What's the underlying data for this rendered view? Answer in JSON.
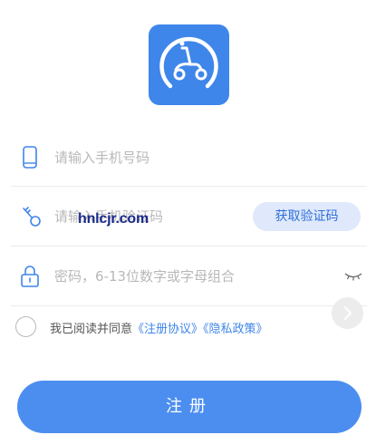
{
  "app": {
    "logo_icon": "scooter-icon",
    "accent_color": "#3f86ea"
  },
  "form": {
    "phone": {
      "placeholder": "请输入手机号码",
      "icon": "phone-icon"
    },
    "code": {
      "placeholder": "请输入手机验证码",
      "icon": "key-icon",
      "button_label": "获取验证码"
    },
    "password": {
      "placeholder": "密码，6-13位数字或字母组合",
      "icon": "lock-icon",
      "toggle_icon": "eye-closed-icon"
    }
  },
  "watermark": "hnlcjr.com",
  "agreement": {
    "prefix": "我已阅读并同意",
    "terms_link": "《注册协议》",
    "privacy_link": "《隐私政策》"
  },
  "submit_label": "注册"
}
